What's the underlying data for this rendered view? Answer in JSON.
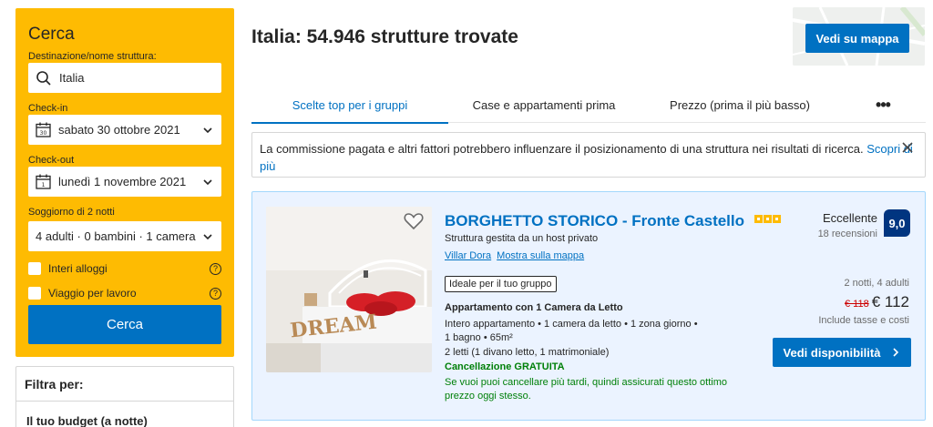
{
  "search": {
    "title": "Cerca",
    "destination_label": "Destinazione/nome struttura:",
    "destination_value": "Italia",
    "checkin_label": "Check-in",
    "checkin_value": "sabato 30 ottobre 2021",
    "checkin_icon_day": "30",
    "checkout_label": "Check-out",
    "checkout_value": "lunedì 1 novembre 2021",
    "checkout_icon_day": "1",
    "stay_label": "Soggiorno di 2 notti",
    "guests_value": "4 adulti · 0 bambini · 1 camera",
    "option_entire": "Interi alloggi",
    "option_business": "Viaggio per lavoro",
    "help_symbol": "?",
    "button": "Cerca"
  },
  "filters": {
    "title": "Filtra per:",
    "budget": "Il tuo budget (a notte)"
  },
  "header": {
    "title": "Italia: 54.946 strutture trovate",
    "map_button": "Vedi su mappa"
  },
  "tabs": [
    {
      "label": "Scelte top per i gruppi",
      "active": true
    },
    {
      "label": "Case e appartamenti prima",
      "active": false
    },
    {
      "label": "Prezzo (prima il più basso)",
      "active": false
    }
  ],
  "tabs_more": "•••",
  "notice": {
    "text": "La commissione pagata e altri fattori potrebbero influenzare il posizionamento di una struttura nei risultati di ricerca. ",
    "link": "Scopri di più"
  },
  "property": {
    "name": "BORGHETTO STORICO - Fronte Castello",
    "stars": 3,
    "host": "Struttura gestita da un host privato",
    "location": "Villar Dora",
    "map_link": "Mostra sulla mappa",
    "badge": "Ideale per il tuo gruppo",
    "room_title": "Appartamento con 1 Camera da Letto",
    "room_line1": "Intero appartamento • 1 camera da letto • 1 zona giorno •",
    "room_line2": "1 bagno • 65m²",
    "room_line3": "2 letti (1 divano letto, 1 matrimoniale)",
    "free_cancel": "Cancellazione GRATUITA",
    "cancel_desc": "Se vuoi puoi cancellare più tardi, quindi assicurati questo ottimo prezzo oggi stesso.",
    "rating_label": "Eccellente",
    "reviews": "18 recensioni",
    "score": "9,0",
    "stay": "2 notti, 4 adulti",
    "old_price": "€ 118",
    "new_price": "€ 112",
    "taxes": "Include tasse e costi",
    "availability_button": "Vedi disponibilità",
    "photo_word": "DREAM"
  },
  "colors": {
    "brand_blue": "#0071c2",
    "search_yellow": "#febb02",
    "score_navy": "#003580",
    "green": "#008009",
    "red_price": "#cc0000"
  }
}
